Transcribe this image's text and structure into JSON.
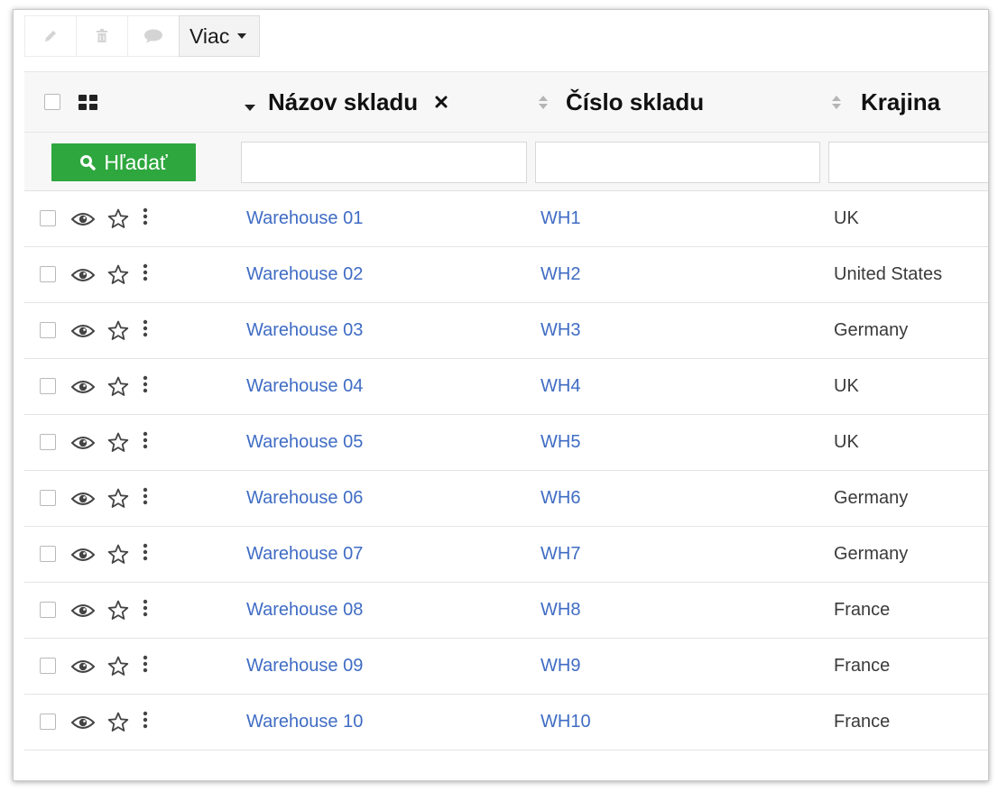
{
  "toolbar": {
    "edit_icon": "pencil-icon",
    "delete_icon": "trash-icon",
    "comment_icon": "comment-icon",
    "more_label": "Viac"
  },
  "grid": {
    "columns": [
      {
        "label": "Názov skladu",
        "sort": "descending",
        "removable": true
      },
      {
        "label": "Číslo skladu",
        "sort": "none"
      },
      {
        "label": "Krajina",
        "sort": "none"
      }
    ],
    "search_label": "Hľadať",
    "filters": [
      "",
      "",
      ""
    ],
    "rows": [
      {
        "name": "Warehouse 01",
        "number": "WH1",
        "country": "UK"
      },
      {
        "name": "Warehouse 02",
        "number": "WH2",
        "country": "United States"
      },
      {
        "name": "Warehouse 03",
        "number": "WH3",
        "country": "Germany"
      },
      {
        "name": "Warehouse 04",
        "number": "WH4",
        "country": "UK"
      },
      {
        "name": "Warehouse 05",
        "number": "WH5",
        "country": "UK"
      },
      {
        "name": "Warehouse 06",
        "number": "WH6",
        "country": "Germany"
      },
      {
        "name": "Warehouse 07",
        "number": "WH7",
        "country": "Germany"
      },
      {
        "name": "Warehouse 08",
        "number": "WH8",
        "country": "France"
      },
      {
        "name": "Warehouse 09",
        "number": "WH9",
        "country": "France"
      },
      {
        "name": "Warehouse 10",
        "number": "WH10",
        "country": "France"
      }
    ]
  },
  "colors": {
    "link": "#3f6cc4",
    "search_button": "#2ea73e",
    "header_bg": "#f7f7f7"
  }
}
